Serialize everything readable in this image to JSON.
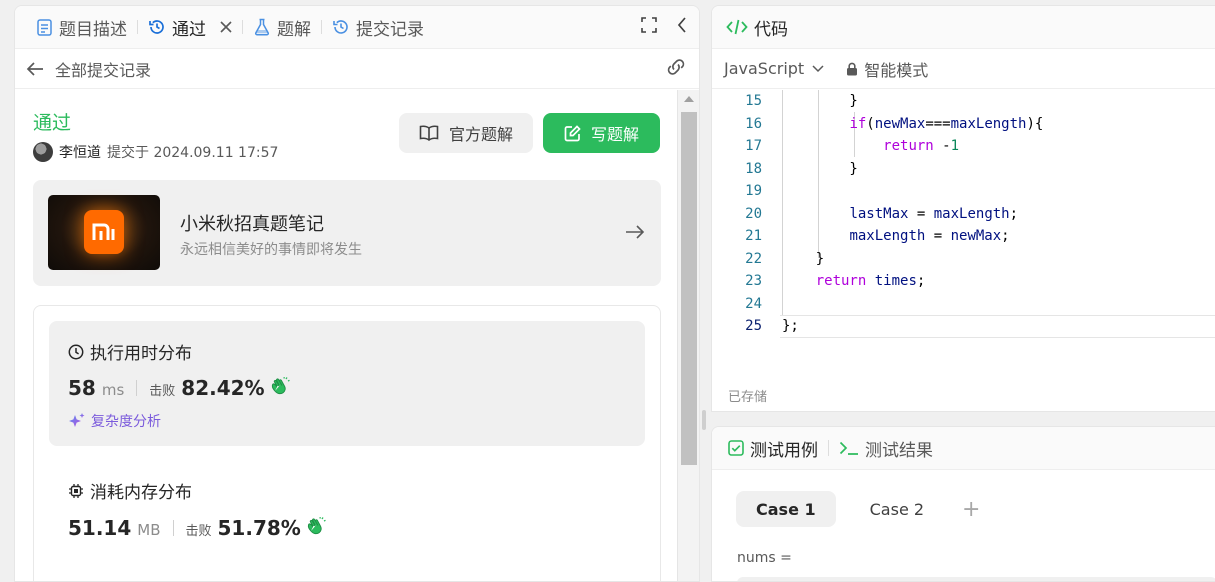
{
  "left_tabs": [
    {
      "label": "题目描述",
      "icon": "description-icon"
    },
    {
      "label": "通过",
      "icon": "history-icon",
      "closable": true
    },
    {
      "label": "题解",
      "icon": "flask-icon"
    },
    {
      "label": "提交记录",
      "icon": "history-icon"
    }
  ],
  "subbar": {
    "back_label": "全部提交记录"
  },
  "submission": {
    "status": "通过",
    "status_color": "#2cbb5d",
    "user": "李恒道",
    "submitted_text": "提交于 2024.09.11 17:57"
  },
  "buttons": {
    "official": "官方题解",
    "write": "写题解"
  },
  "promo": {
    "logo_text": "mi",
    "title": "小米秋招真题笔记",
    "subtitle": "永远相信美好的事情即将发生"
  },
  "runtime": {
    "title": "执行用时分布",
    "value": "58",
    "unit": "ms",
    "beat_label": "击败",
    "percent": "82.42%",
    "complexity_label": "复杂度分析"
  },
  "memory": {
    "title": "消耗内存分布",
    "value": "51.14",
    "unit": "MB",
    "beat_label": "击败",
    "percent": "51.78%"
  },
  "code_panel": {
    "title": "代码",
    "language": "JavaScript",
    "mode": "智能模式",
    "saved": "已存储",
    "lines": [
      {
        "n": "15",
        "text": "        }"
      },
      {
        "n": "16",
        "text": "        if(newMax===maxLength){"
      },
      {
        "n": "17",
        "text": "            return -1"
      },
      {
        "n": "18",
        "text": "        }"
      },
      {
        "n": "19",
        "text": ""
      },
      {
        "n": "20",
        "text": "        lastMax = maxLength;"
      },
      {
        "n": "21",
        "text": "        maxLength = newMax;"
      },
      {
        "n": "22",
        "text": "    }"
      },
      {
        "n": "23",
        "text": "    return times;"
      },
      {
        "n": "24",
        "text": ""
      },
      {
        "n": "25",
        "text": "};"
      }
    ]
  },
  "test_panel": {
    "tab_cases": "测试用例",
    "tab_results": "测试结果",
    "cases": [
      "Case 1",
      "Case 2"
    ],
    "add": "+",
    "input_label": "nums ="
  }
}
